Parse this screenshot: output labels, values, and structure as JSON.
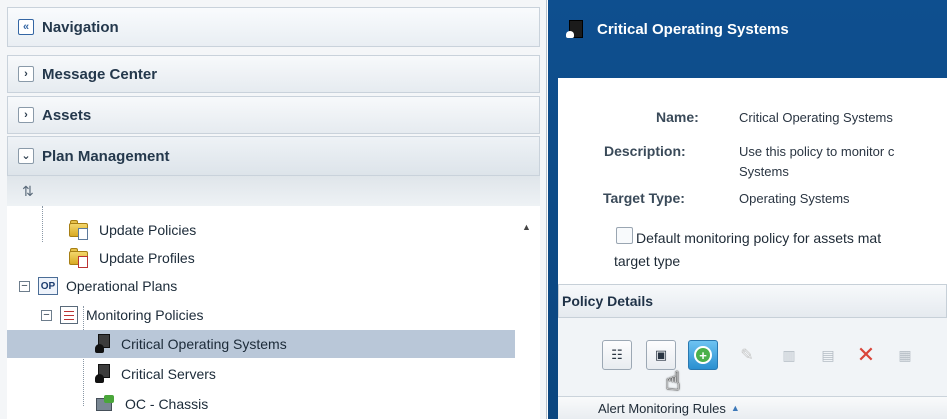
{
  "navigation": {
    "title": "Navigation",
    "collapse_icon": "double-chevron-left-icon",
    "sections": {
      "message_center": "Message Center",
      "assets": "Assets",
      "plan_management": "Plan Management"
    },
    "tree": {
      "update_policies": "Update Policies",
      "update_profiles": "Update Profiles",
      "operational_plans": "Operational Plans",
      "monitoring_policies": "Monitoring Policies",
      "critical_os": "Critical Operating Systems",
      "critical_servers": "Critical Servers",
      "oc_chassis": "OC - Chassis",
      "op_icon_text": "OP"
    }
  },
  "detail": {
    "title": "Critical Operating Systems",
    "labels": {
      "name": "Name:",
      "description": "Description:",
      "target_type": "Target Type:"
    },
    "values": {
      "name": "Critical Operating Systems",
      "description_line1": "Use this policy to monitor c",
      "description_line2": "Systems",
      "target_type": "Operating Systems"
    },
    "default_checkbox_line1": "Default monitoring policy for assets mat",
    "default_checkbox_line2": "target type",
    "default_checked": false,
    "policy_details": "Policy Details",
    "table_column": "Alert Monitoring Rules",
    "sort_glyph": "▲"
  },
  "colors": {
    "header_blue": "#0e4f8f",
    "selected_row": "#b9c7d8",
    "active_button": "#2a8fd0"
  }
}
